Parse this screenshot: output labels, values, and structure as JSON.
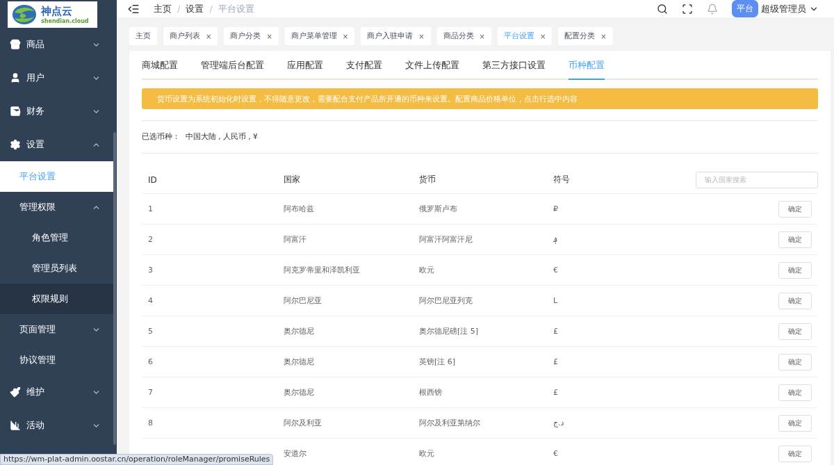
{
  "logo": {
    "name": "神点云",
    "domain": "shendian.cloud"
  },
  "sidebar": {
    "items": [
      {
        "label": "商品",
        "expanded": false,
        "selected": false,
        "hovered": false
      },
      {
        "label": "用户",
        "expanded": false,
        "selected": false,
        "hovered": false
      },
      {
        "label": "财务",
        "expanded": false,
        "selected": false,
        "hovered": false
      },
      {
        "label": "设置",
        "expanded": true,
        "selected": false,
        "hovered": false,
        "children": [
          {
            "label": "平台设置",
            "selected": true,
            "hovered": false
          },
          {
            "label": "管理权限",
            "expanded": true,
            "selected": false,
            "hovered": false,
            "children": [
              {
                "label": "角色管理",
                "selected": false,
                "hovered": false
              },
              {
                "label": "管理员列表",
                "selected": false,
                "hovered": false
              },
              {
                "label": "权限规则",
                "selected": false,
                "hovered": true
              }
            ]
          },
          {
            "label": "页面管理",
            "expanded": false,
            "selected": false,
            "hovered": false
          },
          {
            "label": "协议管理",
            "selected": false,
            "hovered": false
          }
        ]
      },
      {
        "label": "维护",
        "expanded": false,
        "selected": false,
        "hovered": false
      },
      {
        "label": "活动",
        "expanded": false,
        "selected": false,
        "hovered": false
      }
    ]
  },
  "breadcrumb": [
    "主页",
    "设置",
    "平台设置"
  ],
  "breadcrumb_separator": "/",
  "header": {
    "badge": "平台",
    "user": "超级管理员"
  },
  "tags": [
    {
      "label": "主页",
      "closable": false,
      "selected": false
    },
    {
      "label": "商户列表",
      "closable": true,
      "selected": false
    },
    {
      "label": "商户分类",
      "closable": true,
      "selected": false
    },
    {
      "label": "商户菜单管理",
      "closable": true,
      "selected": false
    },
    {
      "label": "商户入驻申请",
      "closable": true,
      "selected": false
    },
    {
      "label": "商品分类",
      "closable": true,
      "selected": false
    },
    {
      "label": "平台设置",
      "closable": true,
      "selected": true
    },
    {
      "label": "配置分类",
      "closable": true,
      "selected": false
    }
  ],
  "close_mark": "×",
  "tabs": [
    {
      "label": "商城配置",
      "selected": false
    },
    {
      "label": "管理端后台配置",
      "selected": false
    },
    {
      "label": "应用配置",
      "selected": false
    },
    {
      "label": "支付配置",
      "selected": false
    },
    {
      "label": "文件上传配置",
      "selected": false
    },
    {
      "label": "第三方接口设置",
      "selected": false
    },
    {
      "label": "币种配置",
      "selected": true
    }
  ],
  "alert": "货币设置为系统初始化时设置，不得随意更改，需要配合支付产品所开通的币种来设置。配置商品价格单位，点击行选中内容",
  "selected_currency": {
    "label": "已选币种：",
    "value": "中国大陆 , 人民币 , ¥"
  },
  "table": {
    "columns": [
      "ID",
      "国家",
      "货币",
      "符号"
    ],
    "search": {
      "placeholder": "输入国家搜索"
    },
    "rows": [
      {
        "id": "1",
        "country": "阿布哈兹",
        "currency": "俄罗斯卢布",
        "symbol": "₽",
        "action": "确定"
      },
      {
        "id": "2",
        "country": "阿富汗",
        "currency": "阿富汗阿富汗尼",
        "symbol": "؋",
        "action": "确定"
      },
      {
        "id": "3",
        "country": "阿克罗蒂里和泽凯利亚",
        "currency": "欧元",
        "symbol": "€",
        "action": "确定"
      },
      {
        "id": "4",
        "country": "阿尔巴尼亚",
        "currency": "阿尔巴尼亚列克",
        "symbol": "L",
        "action": "确定"
      },
      {
        "id": "5",
        "country": "奥尔德尼",
        "currency": "奥尔德尼磅[注 5]",
        "symbol": "£",
        "action": "确定"
      },
      {
        "id": "6",
        "country": "奥尔德尼",
        "currency": "英镑[注 6]",
        "symbol": "£",
        "action": "确定"
      },
      {
        "id": "7",
        "country": "奥尔德尼",
        "currency": "根西镑",
        "symbol": "£",
        "action": "确定"
      },
      {
        "id": "8",
        "country": "阿尔及利亚",
        "currency": "阿尔及利亚第纳尔",
        "symbol": "د.ج",
        "action": "确定"
      },
      {
        "country": "安道尔",
        "currency": "欧元",
        "symbol": "€",
        "action": "确定"
      }
    ]
  },
  "status_link": "https://wm-plat-admin.oostar.cn/operation/roleManager/promiseRules"
}
